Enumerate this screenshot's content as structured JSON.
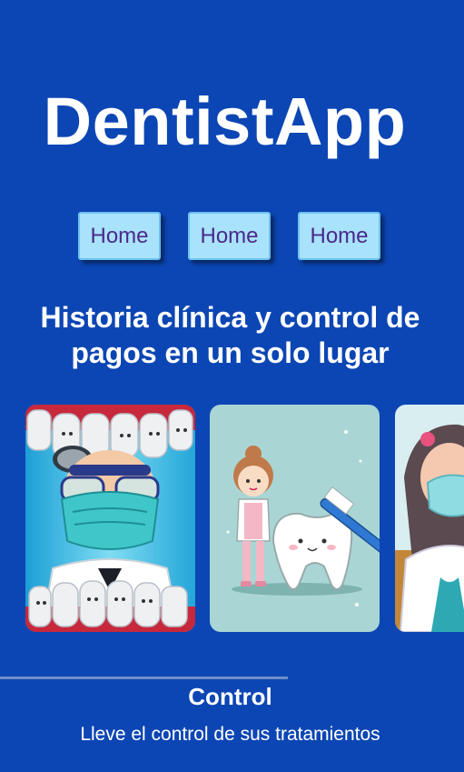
{
  "header": {
    "title": "DentistApp"
  },
  "nav": {
    "items": [
      {
        "label": "Home"
      },
      {
        "label": "Home"
      },
      {
        "label": "Home"
      }
    ]
  },
  "hero": {
    "tagline": "Historia clínica y control de pagos en un solo lugar"
  },
  "carousel": {
    "images": [
      {
        "icon": "dentist-with-teeth-illustration"
      },
      {
        "icon": "tooth-with-toothbrush-illustration"
      },
      {
        "icon": "dentist-woman-illustration"
      }
    ]
  },
  "feature": {
    "title": "Control",
    "description": "Lleve el control de sus tratamientos"
  },
  "colors": {
    "background": "#0c46b4",
    "button_bg": "#a9e2fb",
    "button_text": "#4a2a8c"
  }
}
